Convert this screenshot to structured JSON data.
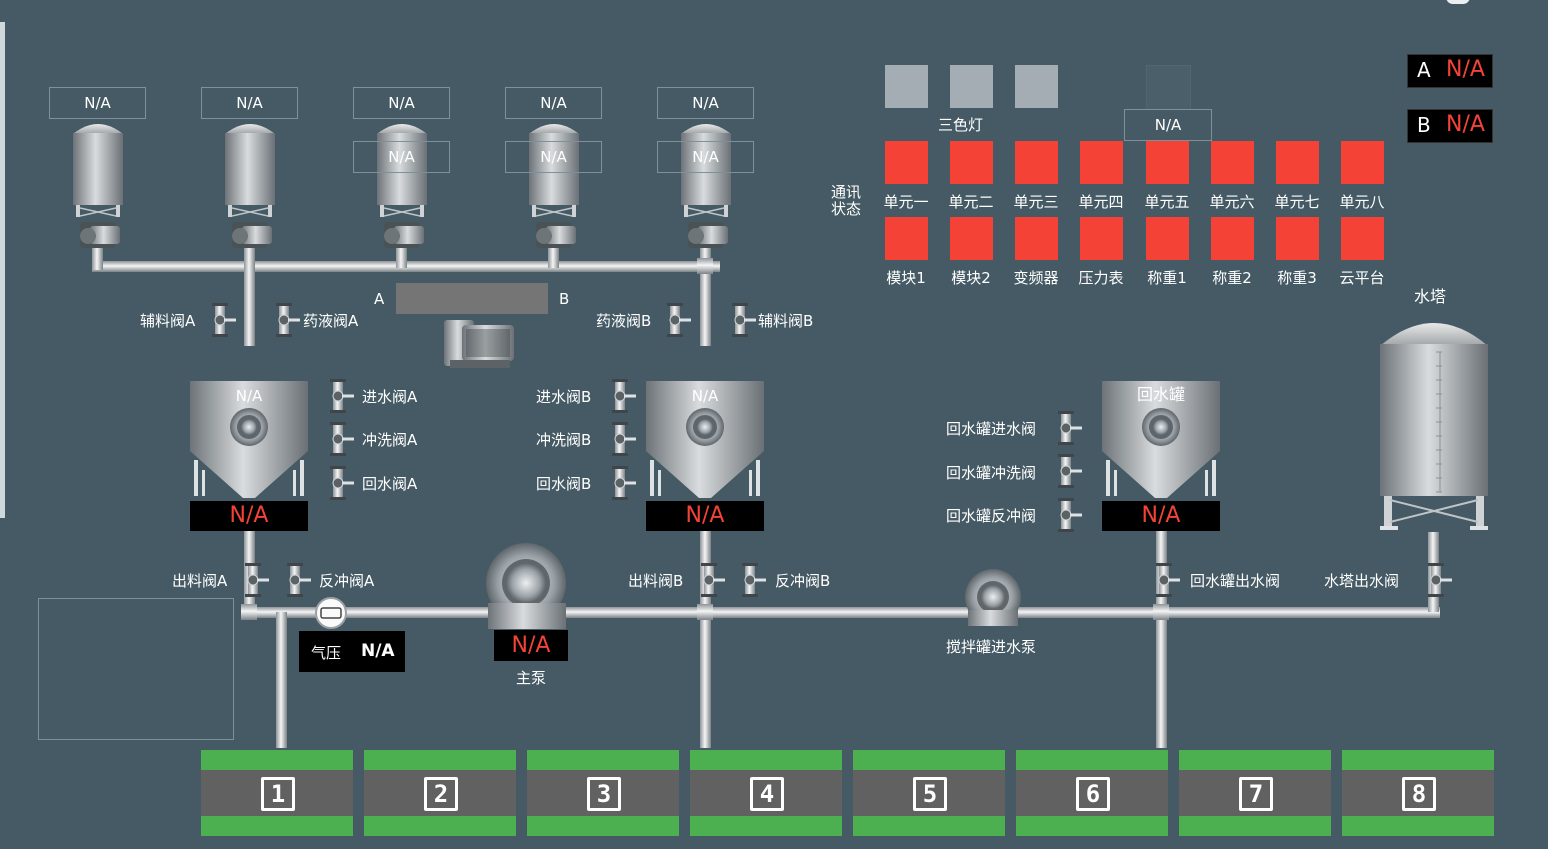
{
  "colors": {
    "bg": "#455a64",
    "red": "#f44336",
    "green": "#4caf50",
    "grey_light": "#a4adb3"
  },
  "silos": [
    {
      "top": "N/A",
      "mid": ""
    },
    {
      "top": "N/A",
      "mid": ""
    },
    {
      "top": "N/A",
      "mid": "N/A"
    },
    {
      "top": "N/A",
      "mid": "N/A"
    },
    {
      "top": "N/A",
      "mid": "N/A"
    }
  ],
  "valves": {
    "aux_a": "辅料阀A",
    "med_a": "药液阀A",
    "med_b": "药液阀B",
    "aux_b": "辅料阀B",
    "inlet_a": "进水阀A",
    "flush_a": "冲洗阀A",
    "return_a": "回水阀A",
    "inlet_b": "进水阀B",
    "flush_b": "冲洗阀B",
    "return_b": "回水阀B",
    "rt_inlet": "回水罐进水阀",
    "rt_flush": "回水罐冲洗阀",
    "rt_backflush": "回水罐反冲阀",
    "out_a": "出料阀A",
    "back_a": "反冲阀A",
    "out_b": "出料阀B",
    "back_b": "反冲阀B",
    "rt_out": "回水罐出水阀",
    "tower_out": "水塔出水阀"
  },
  "mixer": {
    "label_a": "A",
    "label_b": "B"
  },
  "tanks": {
    "a": {
      "name": "N/A",
      "display": "N/A"
    },
    "b": {
      "name": "N/A",
      "display": "N/A"
    },
    "return": {
      "name": "回水罐",
      "display": "N/A"
    }
  },
  "water_tower": {
    "title": "水塔"
  },
  "pressure": {
    "label": "气压",
    "value": "N/A"
  },
  "main_pump": {
    "display": "N/A",
    "label": "主泵"
  },
  "mix_pump": {
    "label": "搅拌罐进水泵"
  },
  "status": {
    "tri_light": "三色灯",
    "tri_extra": "N/A",
    "comm_label": "通讯\n状态",
    "units": [
      "单元一",
      "单元二",
      "单元三",
      "单元四",
      "单元五",
      "单元六",
      "单元七",
      "单元八"
    ],
    "modules": [
      "模块1",
      "模块2",
      "变频器",
      "压力表",
      "称重1",
      "称重2",
      "称重3",
      "云平台"
    ]
  },
  "ab_readouts": [
    {
      "key": "A",
      "value": "N/A"
    },
    {
      "key": "B",
      "value": "N/A"
    }
  ],
  "cells": [
    "1",
    "2",
    "3",
    "4",
    "5",
    "6",
    "7",
    "8"
  ]
}
